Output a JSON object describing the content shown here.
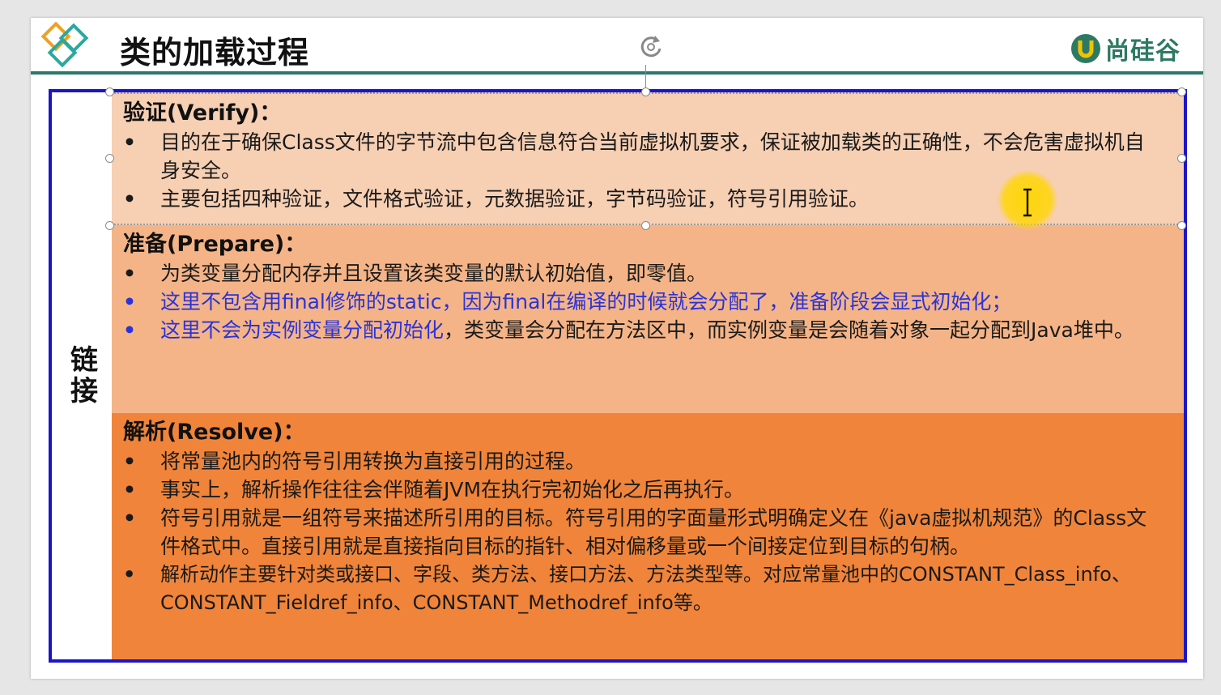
{
  "slide": {
    "title": "类的加载过程",
    "brand": "尚硅谷",
    "side_label": "链接"
  },
  "sections": {
    "verify": {
      "title": "验证(Verify)：",
      "items": [
        {
          "text": "目的在于确保Class文件的字节流中包含信息符合当前虚拟机要求，保证被加载类的正确性，不会危害虚拟机自身安全。"
        },
        {
          "text": "主要包括四种验证，文件格式验证，元数据验证，字节码验证，符号引用验证。"
        }
      ]
    },
    "prepare": {
      "title": "准备(Prepare)：",
      "items": [
        {
          "text": "为类变量分配内存并且设置该类变量的默认初始值，即零值。"
        },
        {
          "text": "这里不包含用final修饰的static，因为final在编译的时候就会分配了，准备阶段会显式初始化；"
        },
        {
          "text_blue": "这里不会为实例变量分配初始化",
          "text_black": "，类变量会分配在方法区中，而实例变量是会随着对象一起分配到Java堆中。"
        }
      ]
    },
    "resolve": {
      "title": "解析(Resolve)：",
      "items": [
        {
          "text": "将常量池内的符号引用转换为直接引用的过程。"
        },
        {
          "text": "事实上，解析操作往往会伴随着JVM在执行完初始化之后再执行。"
        },
        {
          "text": "符号引用就是一组符号来描述所引用的目标。符号引用的字面量形式明确定义在《java虚拟机规范》的Class文件格式中。直接引用就是直接指向目标的指针、相对偏移量或一个间接定位到目标的句柄。"
        },
        {
          "text": "解析动作主要针对类或接口、字段、类方法、接口方法、方法类型等。对应常量池中的CONSTANT_Class_info、CONSTANT_Fieldref_info、CONSTANT_Methodref_info等。"
        }
      ]
    }
  },
  "bullet": "•",
  "colors": {
    "header_rule": "#2a7a6a",
    "frame_border": "#1a16c8",
    "verify_bg": "#f7cfb3",
    "prepare_bg": "#f5b487",
    "resolve_bg": "#f0843a",
    "highlight_text": "#2a33d6",
    "brand_green": "#2d7a63"
  },
  "icons": {
    "logo": "diamond-logo-icon",
    "rotate": "rotate-handle-icon",
    "brand": "brand-u-icon",
    "cursor": "text-cursor-icon"
  }
}
